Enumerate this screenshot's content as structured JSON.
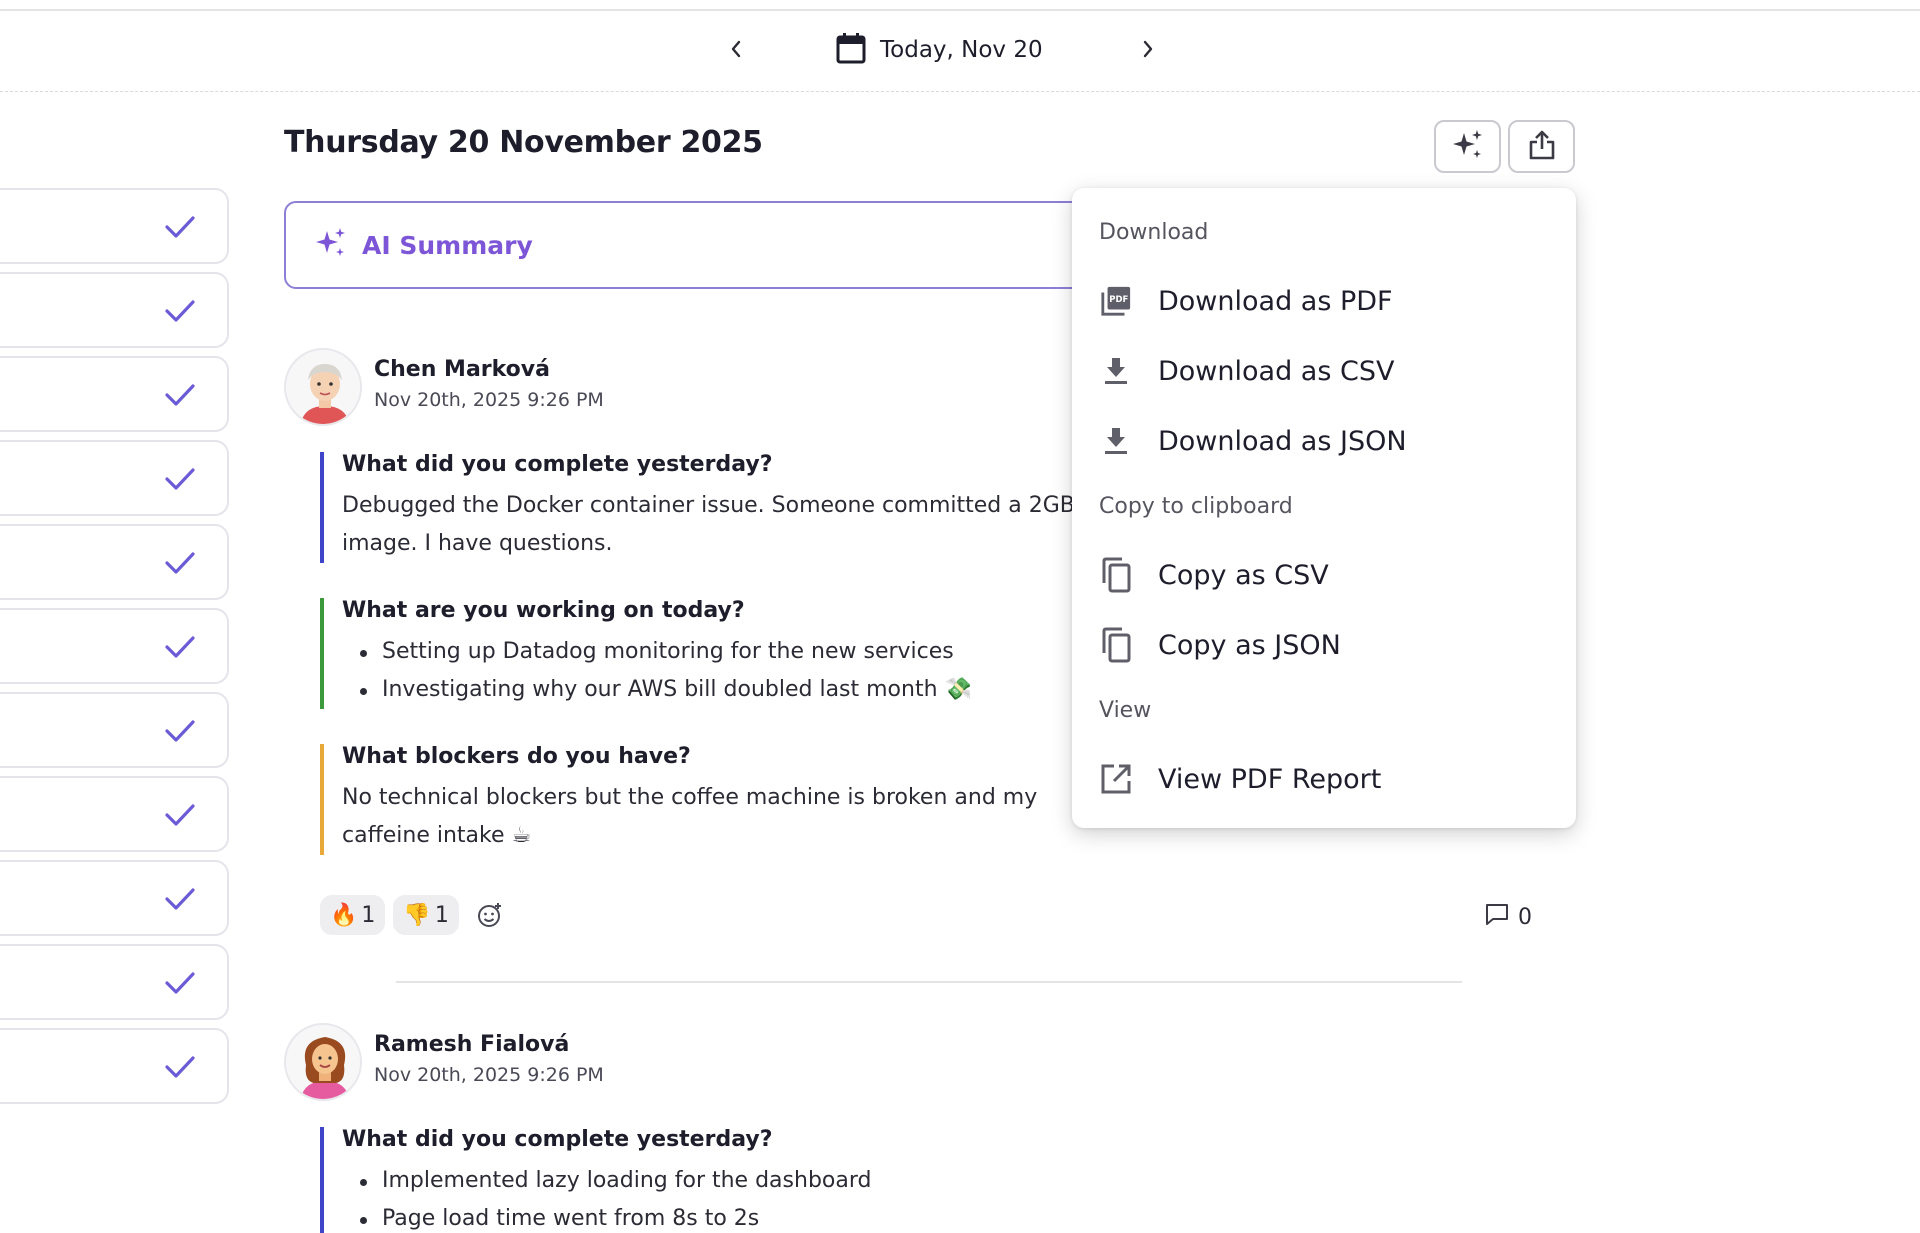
{
  "date_nav": {
    "label": "Today, Nov 20",
    "prev_icon": "chevron-left-icon",
    "next_icon": "chevron-right-icon",
    "calendar_icon": "calendar-icon"
  },
  "page": {
    "title": "Thursday 20 November 2025"
  },
  "ai_summary": {
    "label": "AI Summary",
    "icon": "sparkles-icon"
  },
  "colors": {
    "accent": "#7c56d6",
    "check": "#6b5bd6",
    "yesterday_bar": "#3f45c9",
    "today_bar": "#3c9a3c",
    "blockers_bar": "#e8a938"
  },
  "entries": [
    {
      "name": "Chen Marková",
      "time": "Nov 20th, 2025 9:26 PM",
      "yesterday_q": "What did you complete yesterday?",
      "yesterday_a": "Debugged the Docker container issue. Someone committed a 2GB image. I have questions.",
      "today_q": "What are you working on today?",
      "today_items": [
        "Setting up Datadog monitoring for the new services",
        "Investigating why our AWS bill doubled last month 💸"
      ],
      "blockers_q": "What blockers do you have?",
      "blockers_a": "No technical blockers but the coffee machine is broken and my caffeine intake ☕",
      "reactions": [
        {
          "emoji": "🔥",
          "count": "1"
        },
        {
          "emoji": "👎",
          "count": "1"
        }
      ],
      "comment_count": "0"
    },
    {
      "name": "Ramesh Fialová",
      "time": "Nov 20th, 2025 9:26 PM",
      "yesterday_q": "What did you complete yesterday?",
      "yesterday_items": [
        "Implemented lazy loading for the dashboard",
        "Page load time went from 8s to 2s"
      ]
    }
  ],
  "menu": {
    "sections": {
      "download": "Download",
      "clipboard": "Copy to clipboard",
      "view": "View"
    },
    "items": {
      "download_pdf": "Download as PDF",
      "download_csv": "Download as CSV",
      "download_json": "Download as JSON",
      "copy_csv": "Copy as CSV",
      "copy_json": "Copy as JSON",
      "view_pdf": "View PDF Report"
    }
  }
}
